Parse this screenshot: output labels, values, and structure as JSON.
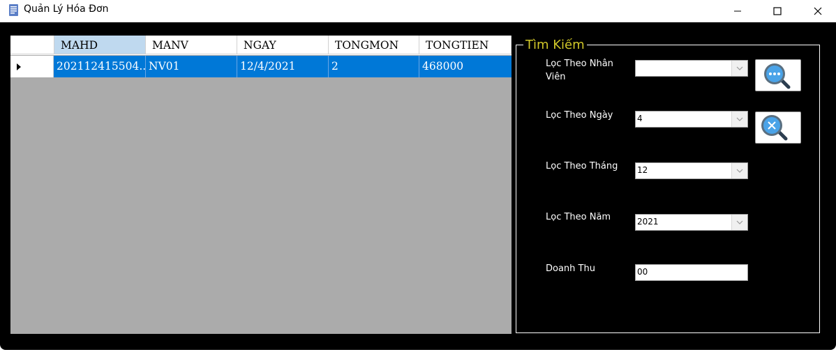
{
  "window": {
    "title": "Quản Lý Hóa Đơn",
    "controls": [
      "minimize-icon",
      "maximize-icon",
      "close-icon"
    ]
  },
  "grid": {
    "columns": [
      "MAHD",
      "MANV",
      "NGAY",
      "TONGMON",
      "TONGTIEN"
    ],
    "selected_column": "MAHD",
    "rows": [
      {
        "cells": [
          "202112415504...",
          "NV01",
          "12/4/2021",
          "2",
          "468000"
        ],
        "selected": true
      }
    ],
    "colors": {
      "selection": "#0078d7",
      "header_selected": "#bfd9ef",
      "empty_area": "#ababab"
    }
  },
  "search": {
    "legend": "Tìm Kiếm",
    "legend_color": "#d1c829",
    "filter_employee": {
      "label": "Lọc Theo Nhân Viên",
      "value": ""
    },
    "filter_day": {
      "label": "Lọc Theo Ngày",
      "value": "4"
    },
    "filter_month": {
      "label": "Lọc Theo Tháng",
      "value": "12"
    },
    "filter_year": {
      "label": "Lọc Theo Năm",
      "value": "2021"
    },
    "revenue": {
      "label": "Doanh Thu",
      "value": "00"
    },
    "search_button_icon": "search-more-icon",
    "clear_button_icon": "search-clear-icon"
  }
}
